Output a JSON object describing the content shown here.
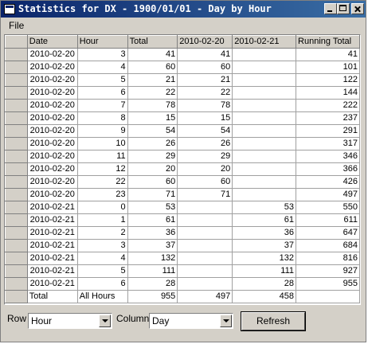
{
  "window": {
    "title": "Statistics for DX - 1900/01/01 - Day by Hour"
  },
  "menu": {
    "file": "File"
  },
  "table": {
    "headers": [
      "Date",
      "Hour",
      "Total",
      "2010-02-20",
      "2010-02-21",
      "Running Total"
    ],
    "rows": [
      [
        "2010-02-20",
        "3",
        "41",
        "41",
        "",
        "41"
      ],
      [
        "2010-02-20",
        "4",
        "60",
        "60",
        "",
        "101"
      ],
      [
        "2010-02-20",
        "5",
        "21",
        "21",
        "",
        "122"
      ],
      [
        "2010-02-20",
        "6",
        "22",
        "22",
        "",
        "144"
      ],
      [
        "2010-02-20",
        "7",
        "78",
        "78",
        "",
        "222"
      ],
      [
        "2010-02-20",
        "8",
        "15",
        "15",
        "",
        "237"
      ],
      [
        "2010-02-20",
        "9",
        "54",
        "54",
        "",
        "291"
      ],
      [
        "2010-02-20",
        "10",
        "26",
        "26",
        "",
        "317"
      ],
      [
        "2010-02-20",
        "11",
        "29",
        "29",
        "",
        "346"
      ],
      [
        "2010-02-20",
        "12",
        "20",
        "20",
        "",
        "366"
      ],
      [
        "2010-02-20",
        "22",
        "60",
        "60",
        "",
        "426"
      ],
      [
        "2010-02-20",
        "23",
        "71",
        "71",
        "",
        "497"
      ],
      [
        "2010-02-21",
        "0",
        "53",
        "",
        "53",
        "550"
      ],
      [
        "2010-02-21",
        "1",
        "61",
        "",
        "61",
        "611"
      ],
      [
        "2010-02-21",
        "2",
        "36",
        "",
        "36",
        "647"
      ],
      [
        "2010-02-21",
        "3",
        "37",
        "",
        "37",
        "684"
      ],
      [
        "2010-02-21",
        "4",
        "132",
        "",
        "132",
        "816"
      ],
      [
        "2010-02-21",
        "5",
        "111",
        "",
        "111",
        "927"
      ],
      [
        "2010-02-21",
        "6",
        "28",
        "",
        "28",
        "955"
      ],
      [
        "Total",
        "All Hours",
        "955",
        "497",
        "458",
        ""
      ]
    ]
  },
  "controls": {
    "row_label": "Row",
    "row_value": "Hour",
    "column_label": "Column",
    "column_value": "Day",
    "refresh_label": "Refresh"
  }
}
